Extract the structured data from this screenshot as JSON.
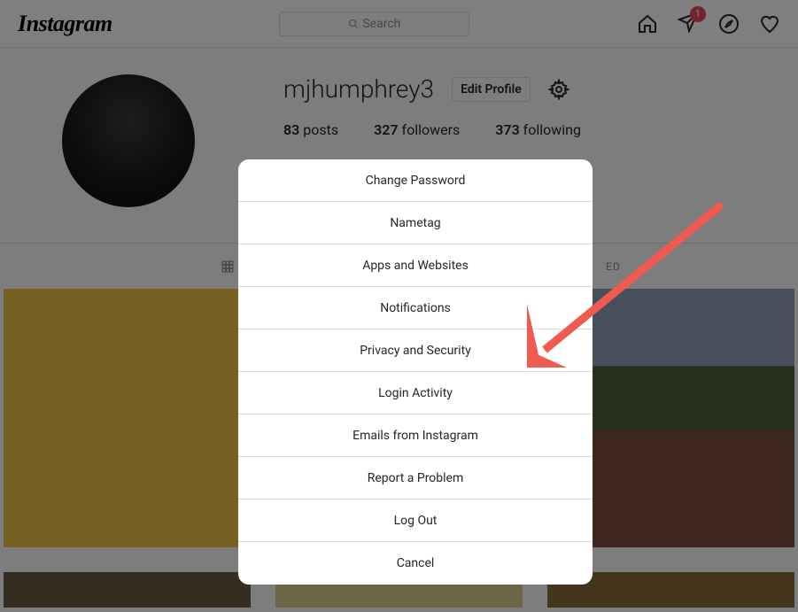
{
  "header": {
    "logo": "Instagram",
    "search_placeholder": "Search",
    "badge_count": "1"
  },
  "profile": {
    "username": "mjhumphrey3",
    "edit_label": "Edit Profile",
    "stats": {
      "posts_count": "83",
      "posts_label": " posts",
      "followers_count": "327",
      "followers_label": " followers",
      "following_count": "373",
      "following_label": " following"
    },
    "tagged_label": "ED"
  },
  "modal": {
    "items": [
      "Change Password",
      "Nametag",
      "Apps and Websites",
      "Notifications",
      "Privacy and Security",
      "Login Activity",
      "Emails from Instagram",
      "Report a Problem",
      "Log Out",
      "Cancel"
    ]
  }
}
